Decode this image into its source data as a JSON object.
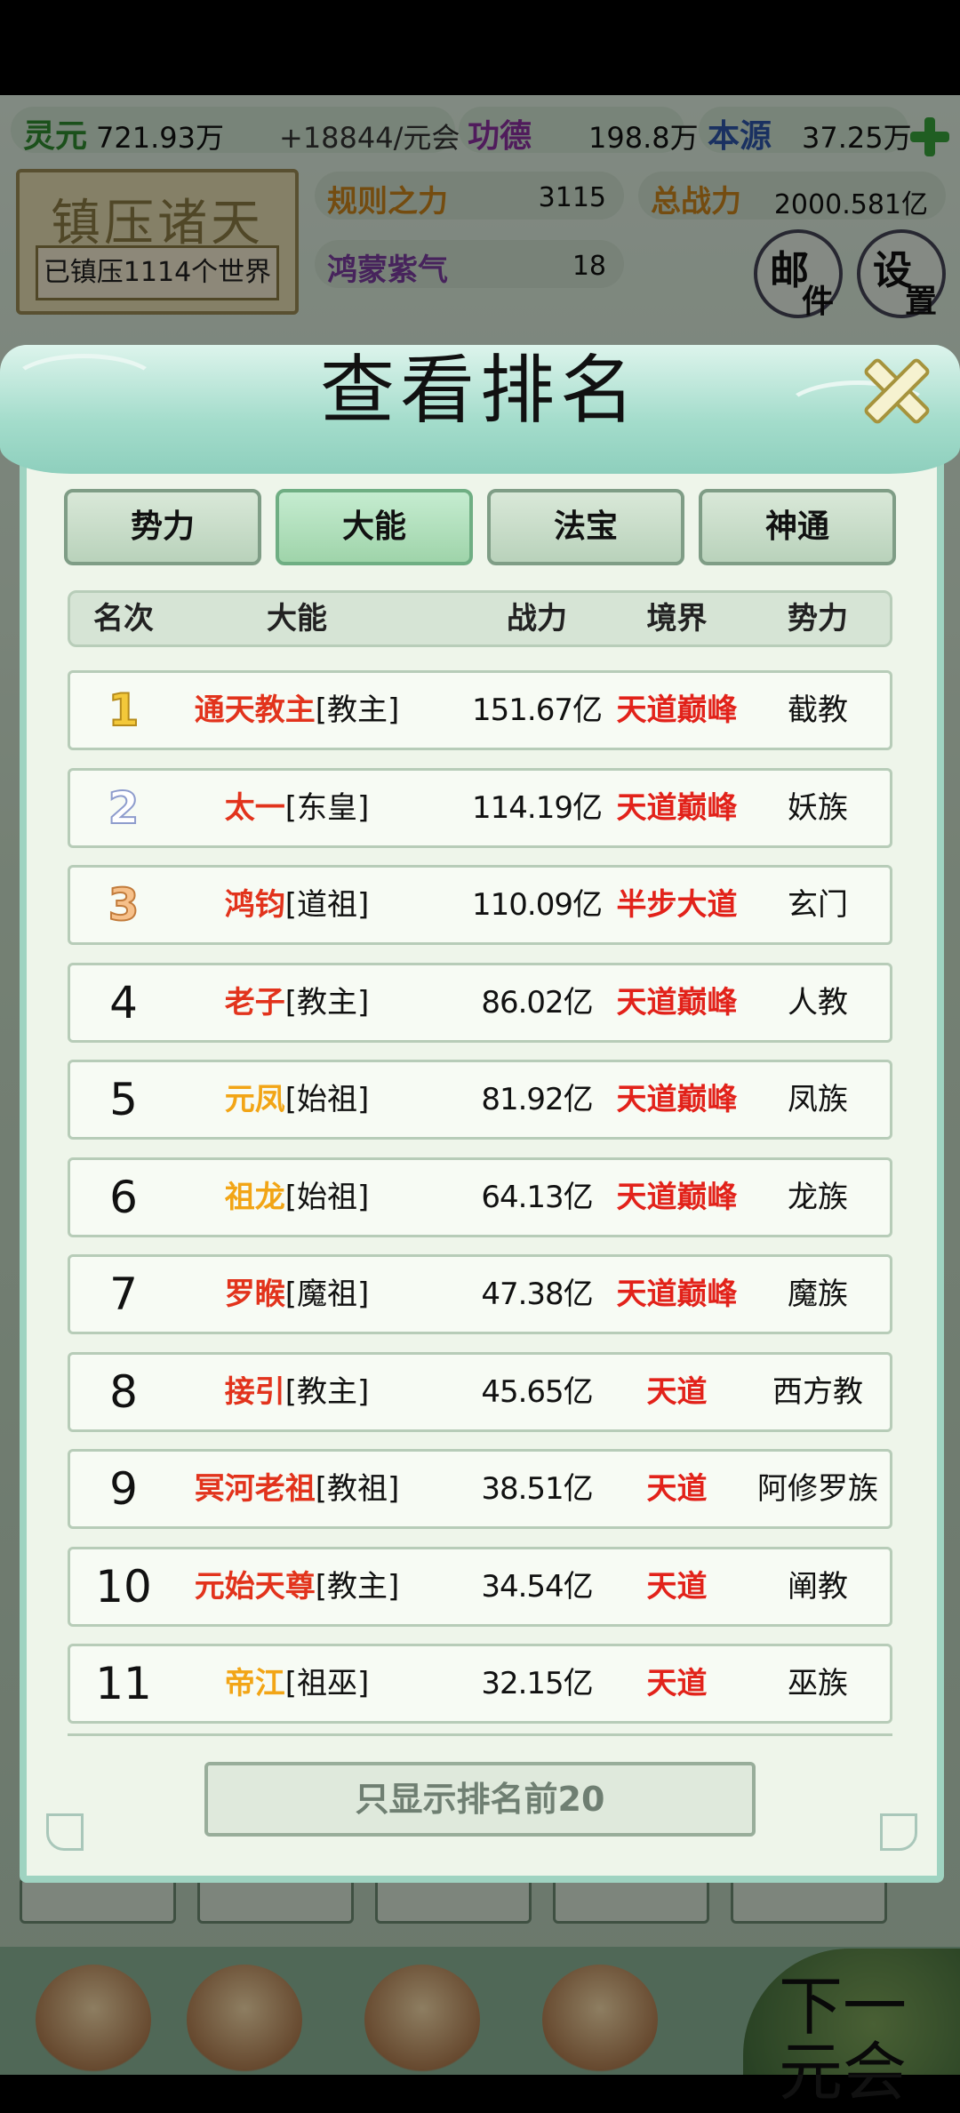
{
  "resources": {
    "lingyuan": {
      "label": "灵元",
      "value": "721.93万"
    },
    "rate": "+18844/元会",
    "gongde": {
      "label": "功德",
      "value": "198.8万"
    },
    "benyuan": {
      "label": "本源",
      "value": "37.25万"
    }
  },
  "plaque": {
    "title": "镇压诸天",
    "subtitle": "已镇压1114个世界"
  },
  "stats": {
    "guize": {
      "label": "规则之力",
      "value": "3115"
    },
    "zongzhanli": {
      "label": "总战力",
      "value": "2000.581亿"
    },
    "hongmeng": {
      "label": "鸿蒙紫气",
      "value": "18"
    }
  },
  "buttons": {
    "mail": {
      "a": "邮",
      "b": "件"
    },
    "settings": {
      "a": "设",
      "b": "置"
    },
    "next": {
      "a": "下一",
      "b": "元会"
    }
  },
  "modal": {
    "title": "查看排名",
    "tabs": [
      {
        "label": "势力",
        "active": false
      },
      {
        "label": "大能",
        "active": true
      },
      {
        "label": "法宝",
        "active": false
      },
      {
        "label": "神通",
        "active": false
      }
    ],
    "columns": [
      "名次",
      "大能",
      "战力",
      "境界",
      "势力"
    ],
    "rows": [
      {
        "rank": "1",
        "name": "通天教主",
        "title": "[教主]",
        "power": "151.67亿",
        "realm": "天道巅峰",
        "faction": "截教",
        "color": "#e2331c"
      },
      {
        "rank": "2",
        "name": "太一",
        "title": "[东皇]",
        "power": "114.19亿",
        "realm": "天道巅峰",
        "faction": "妖族",
        "color": "#e2331c"
      },
      {
        "rank": "3",
        "name": "鸿钧",
        "title": "[道祖]",
        "power": "110.09亿",
        "realm": "半步大道",
        "faction": "玄门",
        "color": "#e2331c"
      },
      {
        "rank": "4",
        "name": "老子",
        "title": "[教主]",
        "power": "86.02亿",
        "realm": "天道巅峰",
        "faction": "人教",
        "color": "#e2331c"
      },
      {
        "rank": "5",
        "name": "元凤",
        "title": "[始祖]",
        "power": "81.92亿",
        "realm": "天道巅峰",
        "faction": "凤族",
        "color": "#f2a516"
      },
      {
        "rank": "6",
        "name": "祖龙",
        "title": "[始祖]",
        "power": "64.13亿",
        "realm": "天道巅峰",
        "faction": "龙族",
        "color": "#f2a516"
      },
      {
        "rank": "7",
        "name": "罗睺",
        "title": "[魔祖]",
        "power": "47.38亿",
        "realm": "天道巅峰",
        "faction": "魔族",
        "color": "#e2331c"
      },
      {
        "rank": "8",
        "name": "接引",
        "title": "[教主]",
        "power": "45.65亿",
        "realm": "天道",
        "faction": "西方教",
        "color": "#e2331c"
      },
      {
        "rank": "9",
        "name": "冥河老祖",
        "title": "[教祖]",
        "power": "38.51亿",
        "realm": "天道",
        "faction": "阿修罗族",
        "color": "#e2331c"
      },
      {
        "rank": "10",
        "name": "元始天尊",
        "title": "[教主]",
        "power": "34.54亿",
        "realm": "天道",
        "faction": "阐教",
        "color": "#e2331c"
      },
      {
        "rank": "11",
        "name": "帝江",
        "title": "[祖巫]",
        "power": "32.15亿",
        "realm": "天道",
        "faction": "巫族",
        "color": "#f2a516"
      }
    ],
    "footer_button": "只显示排名前20"
  }
}
